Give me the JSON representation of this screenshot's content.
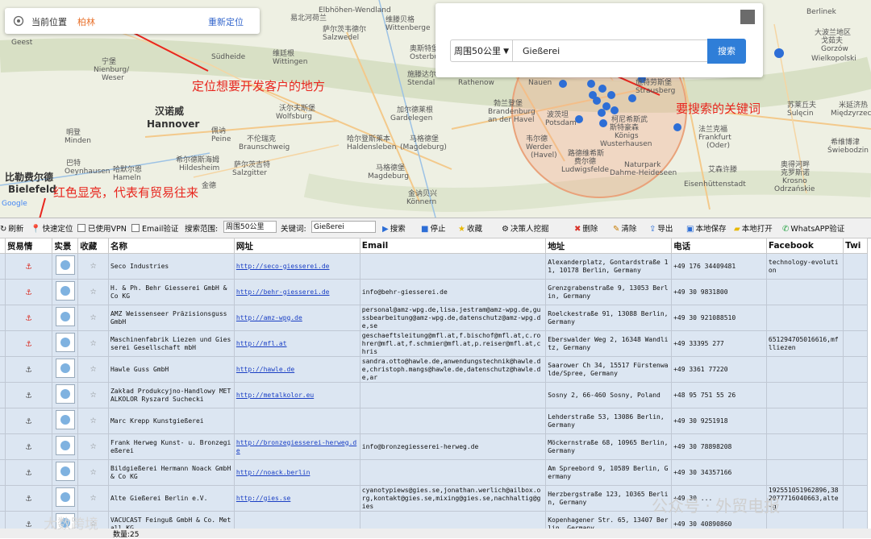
{
  "location_panel": {
    "label": "当前位置",
    "value": "柏林",
    "relocate": "重新定位"
  },
  "search_panel": {
    "range": "周围50公里",
    "keyword": "Gießerei",
    "search": "搜索"
  },
  "annotations": {
    "location": "定位想要开发客户的地方",
    "keyword": "要搜索的关键词",
    "red": "红色显亮，代表有贸易往来"
  },
  "map_places": [
    {
      "name": "Elbhöhen-Wendland"
    },
    {
      "name": "Berlinek"
    },
    {
      "name": "Geest"
    },
    {
      "name": "易北河荷兰"
    },
    {
      "name": "萨尔茨韦德尔"
    },
    {
      "name": "Salzwedel"
    },
    {
      "name": "维滕贝格"
    },
    {
      "name": "Wittenberge"
    },
    {
      "name": "奥斯特堡"
    },
    {
      "name": "Osterburg"
    },
    {
      "name": "宁堡"
    },
    {
      "name": "Nienburg/"
    },
    {
      "name": "Weser"
    },
    {
      "name": "Südheide"
    },
    {
      "name": "维廷根"
    },
    {
      "name": "Wittingen"
    },
    {
      "name": "施滕达尔"
    },
    {
      "name": "Stendal"
    },
    {
      "name": "Rathenow"
    },
    {
      "name": "瑙恩"
    },
    {
      "name": "Nauen"
    },
    {
      "name": "施特劳斯堡"
    },
    {
      "name": "Strausberg"
    },
    {
      "name": "汉诺威"
    },
    {
      "name": "Hannover"
    },
    {
      "name": "沃尔夫斯堡"
    },
    {
      "name": "Wolfsburg"
    },
    {
      "name": "加尔德莱根"
    },
    {
      "name": "Gardelegen"
    },
    {
      "name": "勃兰登堡"
    },
    {
      "name": "Brandenburg"
    },
    {
      "name": "an der Havel"
    },
    {
      "name": "波茨坦"
    },
    {
      "name": "Potsdam"
    },
    {
      "name": "柯尼希斯武"
    },
    {
      "name": "斯特豪森"
    },
    {
      "name": "Königs"
    },
    {
      "name": "Wusterhausen"
    },
    {
      "name": "明登"
    },
    {
      "name": "Minden"
    },
    {
      "name": "不伦瑞克"
    },
    {
      "name": "Braunschweig"
    },
    {
      "name": "哈尔登斯莱本"
    },
    {
      "name": "Haldensleben"
    },
    {
      "name": "马格德堡"
    },
    {
      "name": "(Magdeburg)"
    },
    {
      "name": "韦尔德"
    },
    {
      "name": "Werder"
    },
    {
      "name": "(Havel)"
    },
    {
      "name": "路德维希斯"
    },
    {
      "name": "费尔德"
    },
    {
      "name": "Ludwigsfelde"
    },
    {
      "name": "希尔德斯海姆"
    },
    {
      "name": "Hildesheim"
    },
    {
      "name": "萨尔茨吉特"
    },
    {
      "name": "Salzgitter"
    },
    {
      "name": "马格德堡"
    },
    {
      "name": "Magdeburg"
    },
    {
      "name": "Naturpark"
    },
    {
      "name": "Dahme-Heideseen"
    },
    {
      "name": "比勒费尔德"
    },
    {
      "name": "Bielefeld"
    },
    {
      "name": "巴特"
    },
    {
      "name": "Oeynhausen"
    },
    {
      "name": "哈默尔恩"
    },
    {
      "name": "Hameln"
    },
    {
      "name": "金德"
    },
    {
      "name": "佩讷"
    },
    {
      "name": "Peine"
    },
    {
      "name": "法兰克福"
    },
    {
      "name": "Frankfurt"
    },
    {
      "name": "(Oder)"
    },
    {
      "name": "艾森许滕"
    },
    {
      "name": "Eisenhüttenstadt"
    },
    {
      "name": "大波兰地区"
    },
    {
      "name": "戈茹夫"
    },
    {
      "name": "Gorzów"
    },
    {
      "name": "Wielkopolski"
    },
    {
      "name": "苏莱丘夫"
    },
    {
      "name": "Sulęcin"
    },
    {
      "name": "米延济热"
    },
    {
      "name": "Międzyrzecz"
    },
    {
      "name": "希维博津"
    },
    {
      "name": "Świebodzin"
    },
    {
      "name": "奥得河畔"
    },
    {
      "name": "克罗斯诺"
    },
    {
      "name": "Krosno"
    },
    {
      "name": "Odrzańskie"
    },
    {
      "name": "Google"
    },
    {
      "name": "金讷贝兴"
    },
    {
      "name": "Könnern"
    }
  ],
  "toolbar": {
    "items": [
      {
        "label": "刷新",
        "icon": "refresh-icon"
      },
      {
        "label": "快速定位",
        "icon": "pin-icon"
      },
      {
        "label": "已使用VPN",
        "icon": "checkbox-icon"
      },
      {
        "label": "Email验证",
        "icon": "checkbox-icon"
      },
      {
        "label": "搜索范围:",
        "icon": ""
      },
      {
        "label": "关键词:",
        "icon": ""
      },
      {
        "label": "搜索",
        "icon": "play-icon"
      },
      {
        "label": "停止",
        "icon": "stop-icon"
      },
      {
        "label": "收藏",
        "icon": "star-icon"
      },
      {
        "label": "决策人挖掘",
        "icon": "gear-icon"
      },
      {
        "label": "删除",
        "icon": "delete-icon"
      },
      {
        "label": "清除",
        "icon": "brush-icon"
      },
      {
        "label": "导出",
        "icon": "export-icon"
      },
      {
        "label": "本地保存",
        "icon": "save-icon"
      },
      {
        "label": "本地打开",
        "icon": "folder-icon"
      },
      {
        "label": "WhatsAPP验证",
        "icon": "whatsapp-icon"
      }
    ],
    "range_value": "周围50公里",
    "keyword_value": "Gießerei"
  },
  "table": {
    "headers": [
      "贸易情",
      "实景",
      "收藏",
      "名称",
      "网址",
      "Email",
      "地址",
      "电话",
      "Facebook",
      "Twi"
    ],
    "rows": [
      {
        "trade": "red",
        "name": "Seco Industries",
        "url": "http://seco-giesserei.de",
        "email": "",
        "address": "Alexanderplatz, Gontardstraße 11, 10178 Berlin, Germany",
        "phone": "+49 176 34409481",
        "facebook": "technology-evolution"
      },
      {
        "trade": "red",
        "name": "H. & Ph. Behr Giesserei GmbH & Co KG",
        "url": "http://behr-giesserei.de",
        "email": "info@behr-giesserei.de",
        "address": "Grenzgrabenstraße 9, 13053 Berlin, Germany",
        "phone": "+49 30 9831800",
        "facebook": ""
      },
      {
        "trade": "red",
        "name": "AMZ Weissenseer Präzisionsguss GmbH",
        "url": "http://amz-wpg.de",
        "email": "personal@amz-wpg.de,lisa.jestram@amz-wpg.de,gussbearbeitung@amz-wpg.de,datenschutz@amz-wpg.de,se",
        "address": "Roelckestraße 91, 13088 Berlin, Germany",
        "phone": "+49 30 921088510",
        "facebook": ""
      },
      {
        "trade": "red",
        "name": "Maschinenfabrik Liezen und Giesserei Gesellschaft mbH",
        "url": "http://mfl.at",
        "email": "geschaeftsleitung@mfl.at,f.bischof@mfl.at,c.rohrer@mfl.at,f.schmier@mfl.at,p.reiser@mfl.at,chris",
        "address": "Eberswalder Weg 2, 16348 Wandlitz, Germany",
        "phone": "+49 33395 277",
        "facebook": "651294705016616,mflliezen"
      },
      {
        "trade": "gray",
        "name": "Hawle Guss GmbH",
        "url": "http://hawle.de",
        "email": "sandra.otto@hawle.de,anwendungstechnik@hawle.de,christoph.mangs@hawle.de,datenschutz@hawle.de,ar",
        "address": "Saarower Ch 34, 15517 Fürstenwalde/Spree, Germany",
        "phone": "+49 3361 77220",
        "facebook": ""
      },
      {
        "trade": "gray",
        "name": "Zakład Produkcyjno-Handlowy METALKOLOR Ryszard Suchecki",
        "url": "http://metalkolor.eu",
        "email": "",
        "address": "Sosny 2, 66-460 Sosny, Poland",
        "phone": "+48 95 751 55 26",
        "facebook": ""
      },
      {
        "trade": "gray",
        "name": "Marc Krepp Kunstgießerei",
        "url": "",
        "email": "",
        "address": "Lehderstraße 53, 13086 Berlin, Germany",
        "phone": "+49 30 9251918",
        "facebook": ""
      },
      {
        "trade": "gray",
        "name": "Frank Herweg Kunst- u. Bronzegießerei",
        "url": "http://bronzegiesserei-herweg.de",
        "email": "info@bronzegiesserei-herweg.de",
        "address": "Möckernstraße 68, 10965 Berlin, Germany",
        "phone": "+49 30 78898208",
        "facebook": ""
      },
      {
        "trade": "gray",
        "name": "Bildgießerei Hermann Noack GmbH & Co KG",
        "url": "http://noack.berlin",
        "email": "",
        "address": "Am Spreebord 9, 10589 Berlin, Germany",
        "phone": "+49 30 34357166",
        "facebook": ""
      },
      {
        "trade": "gray",
        "name": "Alte Gießerei Berlin e.V.",
        "url": "http://gies.se",
        "email": "cyanotypiews@gies.se,jonathan.werlich@ailbox.org,kontakt@gies.se,mixing@gies.se,nachhaltig@gies",
        "address": "Herzbergstraße 123, 10365 Berlin, Germany",
        "phone": "+49 30 ...",
        "facebook": "192551051962896,382077716040663,alte-g"
      },
      {
        "trade": "gray",
        "name": "VACUCAST Feinguß GmbH & Co. Metall KG",
        "url": "",
        "email": "",
        "address": "Kopenhagener Str. 65, 13407 Berlin, Germany",
        "phone": "+49 30 40890860",
        "facebook": ""
      }
    ]
  },
  "footer": {
    "count_label": "数量:25"
  },
  "watermarks": {
    "wechat": "公众号 · 外贸电报",
    "brand": "大数跨境"
  }
}
